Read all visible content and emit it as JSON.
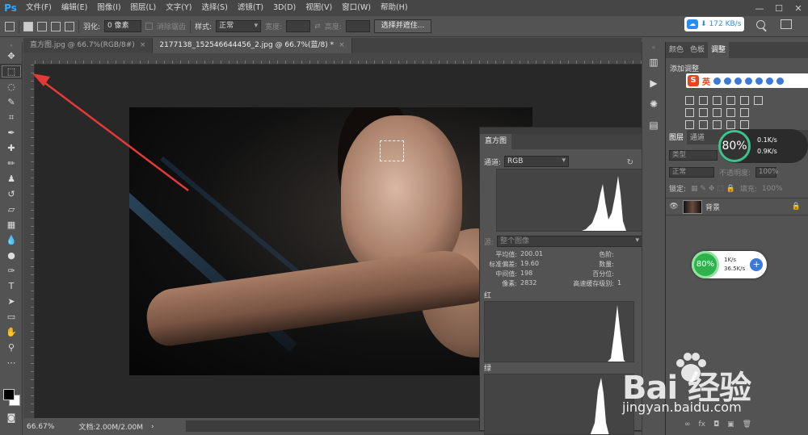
{
  "app": {
    "logo": "Ps"
  },
  "menu": [
    "文件(F)",
    "编辑(E)",
    "图像(I)",
    "图层(L)",
    "文字(Y)",
    "选择(S)",
    "滤镜(T)",
    "3D(D)",
    "视图(V)",
    "窗口(W)",
    "帮助(H)"
  ],
  "window_controls": {
    "minimize": "—",
    "maximize": "☐",
    "close": "✕"
  },
  "options": {
    "feather_label": "羽化:",
    "feather_value": "0 像素",
    "antialias_label": "消除锯齿",
    "style_label": "样式:",
    "style_value": "正常",
    "width_label": "宽度:",
    "height_label": "高度:",
    "select_mask_button": "选择并遮住..."
  },
  "net_speed": {
    "value": "172 KB/s",
    "arrow": "⬇"
  },
  "doc_tabs": [
    {
      "label": "直方图.jpg @ 66.7%(RGB/8#)",
      "close": "×"
    },
    {
      "label": "2177138_152546644456_2.jpg @ 66.7%(蓝/8) *",
      "close": "×"
    }
  ],
  "status": {
    "zoom": "66.67%",
    "doc_info": "文档:2.00M/2.00M",
    "arrow": "›"
  },
  "histogram": {
    "tab": "直方图",
    "channel_label": "通道:",
    "channel_value": "RGB",
    "source_label": "源:",
    "source_value": "整个图像",
    "stats_left": [
      {
        "label": "平均值:",
        "value": "200.01"
      },
      {
        "label": "标准偏差:",
        "value": "19.60"
      },
      {
        "label": "中间值:",
        "value": "198"
      },
      {
        "label": "像素:",
        "value": "2832"
      }
    ],
    "stats_right": [
      {
        "label": "色阶:",
        "value": ""
      },
      {
        "label": "数量:",
        "value": ""
      },
      {
        "label": "百分位:",
        "value": ""
      },
      {
        "label": "高速缓存级别:",
        "value": "1"
      }
    ],
    "red_label": "红",
    "green_label": "绿"
  },
  "right_panel": {
    "tabs": [
      "颜色",
      "色板",
      "调整"
    ],
    "adjust_title": "添加调整",
    "ime_text": "英",
    "layers_tabs": [
      "图层",
      "通道"
    ],
    "kind_label": "类型",
    "blend_value": "正常",
    "opacity_label": "不透明度:",
    "opacity_value": "100%",
    "lock_label": "锁定:",
    "fill_label": "填充:",
    "fill_value": "100%",
    "layer_name": "背景"
  },
  "monitor1": {
    "percent": "80%",
    "up": "0.1K/s",
    "down": "0.9K/s"
  },
  "monitor2": {
    "percent": "80%",
    "up": "1K/s",
    "down": "36.5K/s"
  },
  "watermark": {
    "brand": "Bai  经验",
    "url": "jingyan.baidu.com"
  },
  "colors": {
    "accent": "#31a8ff",
    "arrow": "#e53935",
    "monitor_green": "#2eb24c"
  }
}
